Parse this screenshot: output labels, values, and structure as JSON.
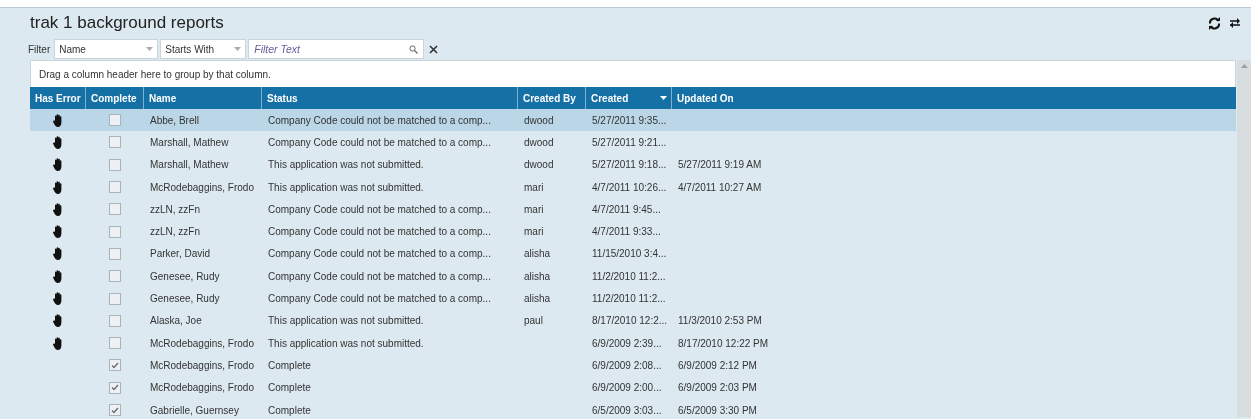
{
  "title": "trak 1 background reports",
  "filter": {
    "label": "Filter",
    "field": "Name",
    "operator": "Starts With",
    "placeholder": "Filter Text"
  },
  "group_hint": "Drag a column header here to group by that column.",
  "table": {
    "columns": [
      {
        "label": "Has Error",
        "sorted": false
      },
      {
        "label": "Complete",
        "sorted": false
      },
      {
        "label": "Name",
        "sorted": false
      },
      {
        "label": "Status",
        "sorted": false
      },
      {
        "label": "Created By",
        "sorted": false
      },
      {
        "label": "Created",
        "sorted": true
      },
      {
        "label": "Updated On",
        "sorted": false
      }
    ],
    "rows": [
      {
        "selected": true,
        "has_error": true,
        "complete": false,
        "name": "Abbe, Brell",
        "status": "Company Code could not be matched to a comp...",
        "created_by": "dwood",
        "created": "5/27/2011 9:35..."
      },
      {
        "selected": false,
        "has_error": true,
        "complete": false,
        "name": "Marshall, Mathew",
        "status": "Company Code could not be matched to a comp...",
        "created_by": "dwood",
        "created": "5/27/2011 9:21..."
      },
      {
        "selected": false,
        "has_error": true,
        "complete": false,
        "name": "Marshall, Mathew",
        "status": "This application was not submitted.",
        "created_by": "dwood",
        "created": "5/27/2011 9:18...",
        "updated_on": "5/27/2011 9:19 AM"
      },
      {
        "selected": false,
        "has_error": true,
        "complete": false,
        "name": "McRodebaggins, Frodo",
        "status": "This application was not submitted.",
        "created_by": "mari",
        "created": "4/7/2011 10:26...",
        "updated_on": "4/7/2011 10:27 AM"
      },
      {
        "selected": false,
        "has_error": true,
        "complete": false,
        "name": "zzLN, zzFn",
        "status": "Company Code could not be matched to a comp...",
        "created_by": "mari",
        "created": "4/7/2011 9:45..."
      },
      {
        "selected": false,
        "has_error": true,
        "complete": false,
        "name": "zzLN, zzFn",
        "status": "Company Code could not be matched to a comp...",
        "created_by": "mari",
        "created": "4/7/2011 9:33..."
      },
      {
        "selected": false,
        "has_error": true,
        "complete": false,
        "name": "Parker, David",
        "status": "Company Code could not be matched to a comp...",
        "created_by": "alisha",
        "created": "11/15/2010 3:4..."
      },
      {
        "selected": false,
        "has_error": true,
        "complete": false,
        "name": "Genesee, Rudy",
        "status": "Company Code could not be matched to a comp...",
        "created_by": "alisha",
        "created": "11/2/2010 11:2..."
      },
      {
        "selected": false,
        "has_error": true,
        "complete": false,
        "name": "Genesee, Rudy",
        "status": "Company Code could not be matched to a comp...",
        "created_by": "alisha",
        "created": "11/2/2010 11:2..."
      },
      {
        "selected": false,
        "has_error": true,
        "complete": false,
        "name": "Alaska, Joe",
        "status": "This application was not submitted.",
        "created_by": "paul",
        "created": "8/17/2010 12:2...",
        "updated_on": "11/3/2010 2:53 PM"
      },
      {
        "selected": false,
        "has_error": true,
        "complete": false,
        "name": "McRodebaggins, Frodo",
        "status": "This application was not submitted.",
        "created": "6/9/2009 2:39...",
        "updated_on": "8/17/2010 12:22 PM"
      },
      {
        "selected": false,
        "has_error": false,
        "complete": true,
        "name": "McRodebaggins, Frodo",
        "status": "Complete",
        "created": "6/9/2009 2:08...",
        "updated_on": "6/9/2009 2:12 PM"
      },
      {
        "selected": false,
        "has_error": false,
        "complete": true,
        "name": "McRodebaggins, Frodo",
        "status": "Complete",
        "created": "6/9/2009 2:00...",
        "updated_on": "6/9/2009 2:03 PM"
      },
      {
        "selected": false,
        "has_error": false,
        "complete": true,
        "name": "Gabrielle, Guernsey",
        "status": "Complete",
        "created": "6/5/2009 3:03...",
        "updated_on": "6/5/2009 3:30 PM"
      }
    ]
  }
}
